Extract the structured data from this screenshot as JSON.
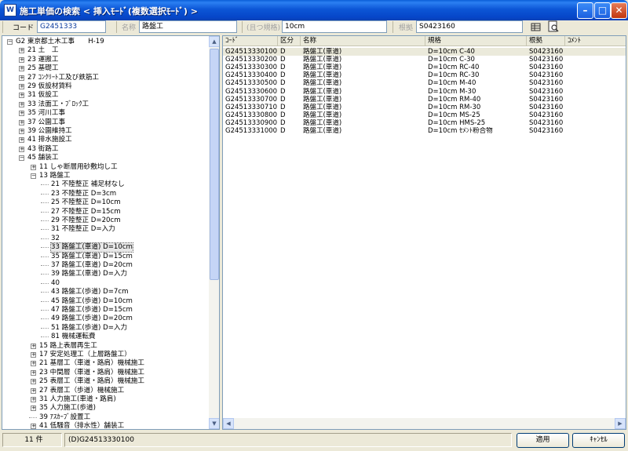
{
  "window": {
    "title": "施工単価の検索 < 挿入ﾓｰﾄﾞ(複数選択ﾓｰﾄﾞ) >",
    "app_icon_label": "W"
  },
  "search": {
    "code_label": "コード",
    "code_value": "G2451333",
    "name_label": "名称",
    "name_value": "路盤工",
    "spec_label": "(且つ規格)",
    "spec_value": "10cm",
    "basis_label": "根拠",
    "basis_value": "S0423160"
  },
  "tree": {
    "root": "G2 東京都土木工事 H-19",
    "rows": [
      {
        "depth": 0,
        "exp": "−",
        "text": "G2 東京都土木工事　　H-19"
      },
      {
        "depth": 1,
        "exp": "+",
        "text": "21 土　工"
      },
      {
        "depth": 1,
        "exp": "+",
        "text": "23 運搬工"
      },
      {
        "depth": 1,
        "exp": "+",
        "text": "25 基礎工"
      },
      {
        "depth": 1,
        "exp": "+",
        "text": "27 ｺﾝｸﾘｰﾄ工及び鉄筋工"
      },
      {
        "depth": 1,
        "exp": "+",
        "text": "29 仮設材賃料"
      },
      {
        "depth": 1,
        "exp": "+",
        "text": "31 仮設工"
      },
      {
        "depth": 1,
        "exp": "+",
        "text": "33 法面工・ﾌﾞﾛｯｸ工"
      },
      {
        "depth": 1,
        "exp": "+",
        "text": "35 河川工事"
      },
      {
        "depth": 1,
        "exp": "+",
        "text": "37 公園工事"
      },
      {
        "depth": 1,
        "exp": "+",
        "text": "39 公園維持工"
      },
      {
        "depth": 1,
        "exp": "+",
        "text": "41 排水施設工"
      },
      {
        "depth": 1,
        "exp": "+",
        "text": "43 街路工"
      },
      {
        "depth": 1,
        "exp": "−",
        "text": "45 舗装工"
      },
      {
        "depth": 2,
        "exp": "+",
        "text": "11 しゃ断層用砂敷均し工"
      },
      {
        "depth": 2,
        "exp": "−",
        "text": "13 路盤工"
      },
      {
        "depth": 3,
        "exp": "",
        "text": "21 不陸整正 補足材なし"
      },
      {
        "depth": 3,
        "exp": "",
        "text": "23 不陸整正 D=3cm"
      },
      {
        "depth": 3,
        "exp": "",
        "text": "25 不陸整正 D=10cm"
      },
      {
        "depth": 3,
        "exp": "",
        "text": "27 不陸整正 D=15cm"
      },
      {
        "depth": 3,
        "exp": "",
        "text": "29 不陸整正 D=20cm"
      },
      {
        "depth": 3,
        "exp": "",
        "text": "31 不陸整正 D=入力"
      },
      {
        "depth": 3,
        "exp": "",
        "text": "32"
      },
      {
        "depth": 3,
        "exp": "",
        "text": "33 路盤工(車道) D=10cm",
        "selected": true
      },
      {
        "depth": 3,
        "exp": "",
        "text": "35 路盤工(車道) D=15cm"
      },
      {
        "depth": 3,
        "exp": "",
        "text": "37 路盤工(車道) D=20cm"
      },
      {
        "depth": 3,
        "exp": "",
        "text": "39 路盤工(車道) D=入力"
      },
      {
        "depth": 3,
        "exp": "",
        "text": "40"
      },
      {
        "depth": 3,
        "exp": "",
        "text": "43 路盤工(歩道) D=7cm"
      },
      {
        "depth": 3,
        "exp": "",
        "text": "45 路盤工(歩道) D=10cm"
      },
      {
        "depth": 3,
        "exp": "",
        "text": "47 路盤工(歩道) D=15cm"
      },
      {
        "depth": 3,
        "exp": "",
        "text": "49 路盤工(歩道) D=20cm"
      },
      {
        "depth": 3,
        "exp": "",
        "text": "51 路盤工(歩道) D=入力"
      },
      {
        "depth": 3,
        "exp": "",
        "text": "81 機械運転費"
      },
      {
        "depth": 2,
        "exp": "+",
        "text": "15 路上表層再生工"
      },
      {
        "depth": 2,
        "exp": "+",
        "text": "17 安定処理工（上層路盤工）"
      },
      {
        "depth": 2,
        "exp": "+",
        "text": "21 基層工（車道・路肩）機械施工"
      },
      {
        "depth": 2,
        "exp": "+",
        "text": "23 中間層（車道・路肩）機械施工"
      },
      {
        "depth": 2,
        "exp": "+",
        "text": "25 表層工（車道・路肩）機械施工"
      },
      {
        "depth": 2,
        "exp": "+",
        "text": "27 表層工（歩道）機械施工"
      },
      {
        "depth": 2,
        "exp": "+",
        "text": "31 人力施工(車道・路肩)"
      },
      {
        "depth": 2,
        "exp": "+",
        "text": "35 人力施工(歩道)"
      },
      {
        "depth": 2,
        "exp": "",
        "text": "39 ｱｽｶｰﾌﾞ設置工"
      },
      {
        "depth": 2,
        "exp": "+",
        "text": "41 低騒音（排水性）舗装工"
      },
      {
        "depth": 2,
        "exp": "+",
        "text": "43 半たわみ性ｾﾒﾝﾄﾐﾙｸ浸透工"
      },
      {
        "depth": 2,
        "exp": "+",
        "text": "45 薄層ｶﾗｰ舗装工(市場単価)"
      }
    ]
  },
  "table": {
    "columns": [
      "ｺｰﾄﾞ",
      "区分",
      "名称",
      "規格",
      "根拠",
      "ｺﾒﾝﾄ"
    ],
    "rows": [
      [
        "G24513330100",
        "D",
        "路盤工(車道)",
        "D=10cm  C-40",
        "S0423160",
        ""
      ],
      [
        "G24513330200",
        "D",
        "路盤工(車道)",
        "D=10cm  C-30",
        "S0423160",
        ""
      ],
      [
        "G24513330300",
        "D",
        "路盤工(車道)",
        "D=10cm  RC-40",
        "S0423160",
        ""
      ],
      [
        "G24513330400",
        "D",
        "路盤工(車道)",
        "D=10cm  RC-30",
        "S0423160",
        ""
      ],
      [
        "G24513330500",
        "D",
        "路盤工(車道)",
        "D=10cm  M-40",
        "S0423160",
        ""
      ],
      [
        "G24513330600",
        "D",
        "路盤工(車道)",
        "D=10cm  M-30",
        "S0423160",
        ""
      ],
      [
        "G24513330700",
        "D",
        "路盤工(車道)",
        "D=10cm  RM-40",
        "S0423160",
        ""
      ],
      [
        "G24513330710",
        "D",
        "路盤工(車道)",
        "D=10cm  RM-30",
        "S0423160",
        ""
      ],
      [
        "G24513330800",
        "D",
        "路盤工(車道)",
        "D=10cm  MS-25",
        "S0423160",
        ""
      ],
      [
        "G24513330900",
        "D",
        "路盤工(車道)",
        "D=10cm  HMS-25",
        "S0423160",
        ""
      ],
      [
        "G24513331000",
        "D",
        "路盤工(車道)",
        "D=10cm  ｾﾒﾝﾄ粉合物",
        "S0423160",
        ""
      ]
    ]
  },
  "status": {
    "count": "11 件",
    "selected_code": "(D)G24513330100",
    "apply_label": "適用",
    "cancel_label": "ｷｬﾝｾﾙ"
  }
}
